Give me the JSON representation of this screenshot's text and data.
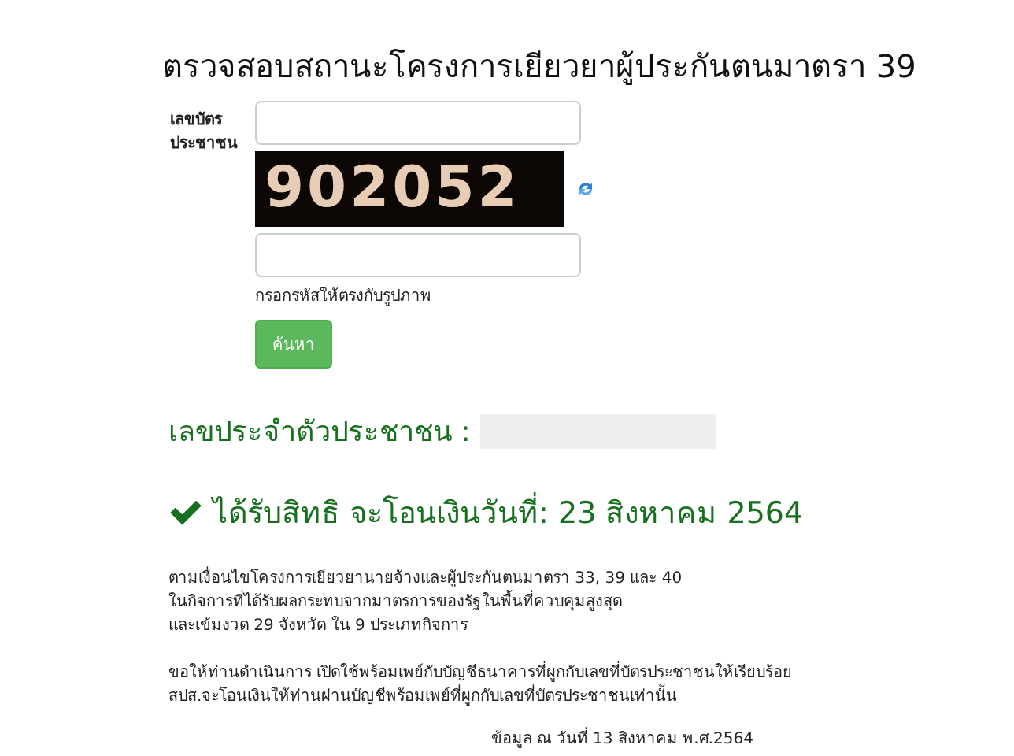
{
  "title": "ตรวจสอบสถานะโครงการเยียวยาผู้ประกันตนมาตรา 39",
  "form": {
    "id_label": "เลขบัตรประชาชน",
    "captcha_code": "902052",
    "captcha_hint": "กรอกรหัสให้ตรงกับรูปภาพ",
    "search_button": "ค้นหา"
  },
  "result": {
    "id_label": "เลขประจำตัวประชาชน :",
    "eligible": true,
    "message": "ได้รับสิทธิ จะโอนเงินวันที่: 23 สิงหาคม 2564"
  },
  "paragraphs": [
    [
      "ตามเงื่อนไขโครงการเยียวยานายจ้างและผู้ประกันตนมาตรา 33, 39 และ 40",
      "ในกิจการที่ได้รับผลกระทบจากมาตรการของรัฐในพื้นที่ควบคุมสูงสุด",
      "และเข้มงวด 29 จังหวัด ใน 9 ประเภทกิจการ"
    ],
    [
      "ขอให้ท่านดำเนินการ เปิดใช้พร้อมเพย์กับบัญชีธนาคารที่ผูกกับเลขที่บัตรประชาชนให้เรียบร้อย",
      "สปส.จะโอนเงินให้ท่านผ่านบัญชีพร้อมเพย์ที่ผูกกับเลขที่บัตรประชาชนเท่านั้น"
    ]
  ],
  "data_date": "ข้อมูล ณ วันที่ 13 สิงหาคม พ.ศ.2564"
}
